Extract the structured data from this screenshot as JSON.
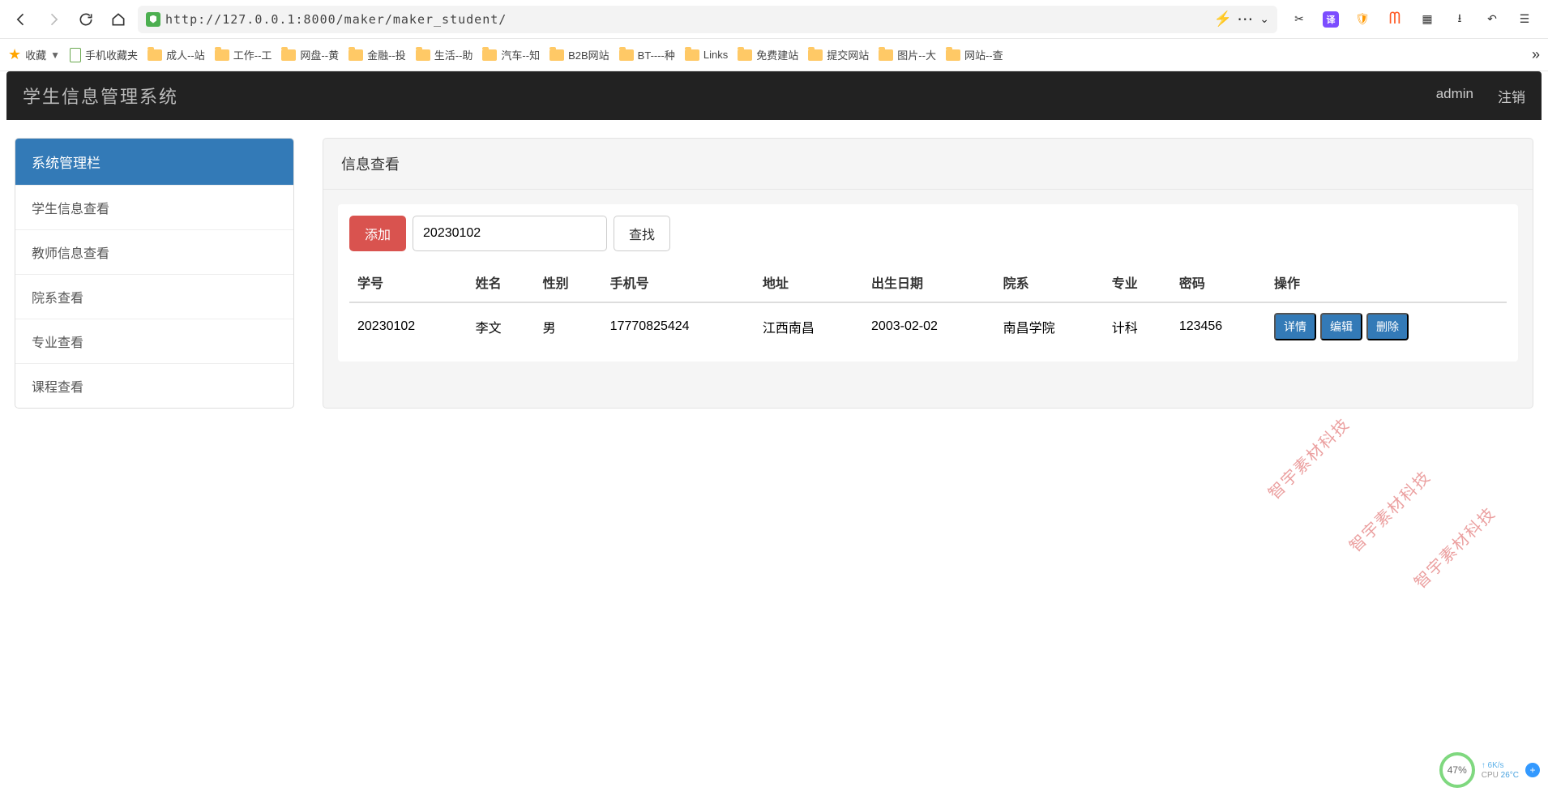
{
  "browser": {
    "url": "http://127.0.0.1:8000/maker/maker_student/"
  },
  "bookmarks": {
    "fav_label": "收藏",
    "mobile_label": "手机收藏夹",
    "items": [
      "成人--站",
      "工作--工",
      "网盘--黄",
      "金融--投",
      "生活--助",
      "汽车--知",
      "B2B网站",
      "BT----种",
      "Links",
      "免费建站",
      "提交网站",
      "图片--大",
      "网站--查"
    ]
  },
  "app": {
    "title": "学生信息管理系统",
    "user": "admin",
    "logout": "注销"
  },
  "sidebar": {
    "header": "系统管理栏",
    "items": [
      "学生信息查看",
      "教师信息查看",
      "院系查看",
      "专业查看",
      "课程查看"
    ]
  },
  "panel": {
    "title": "信息查看",
    "add_btn": "添加",
    "search_value": "20230102",
    "search_btn": "查找"
  },
  "table": {
    "headers": [
      "学号",
      "姓名",
      "性别",
      "手机号",
      "地址",
      "出生日期",
      "院系",
      "专业",
      "密码",
      "操作"
    ],
    "rows": [
      {
        "id": "20230102",
        "name": "李文",
        "gender": "男",
        "phone": "17770825424",
        "address": "江西南昌",
        "birth": "2003-02-02",
        "college": "南昌学院",
        "major": "计科",
        "password": "123456"
      }
    ],
    "ops": {
      "detail": "详情",
      "edit": "编辑",
      "delete": "删除"
    }
  },
  "watermark": "智宇素材科技",
  "widget": {
    "percent": "47%",
    "up": "6K/s",
    "cpu_label": "CPU",
    "temp": "26°C"
  }
}
